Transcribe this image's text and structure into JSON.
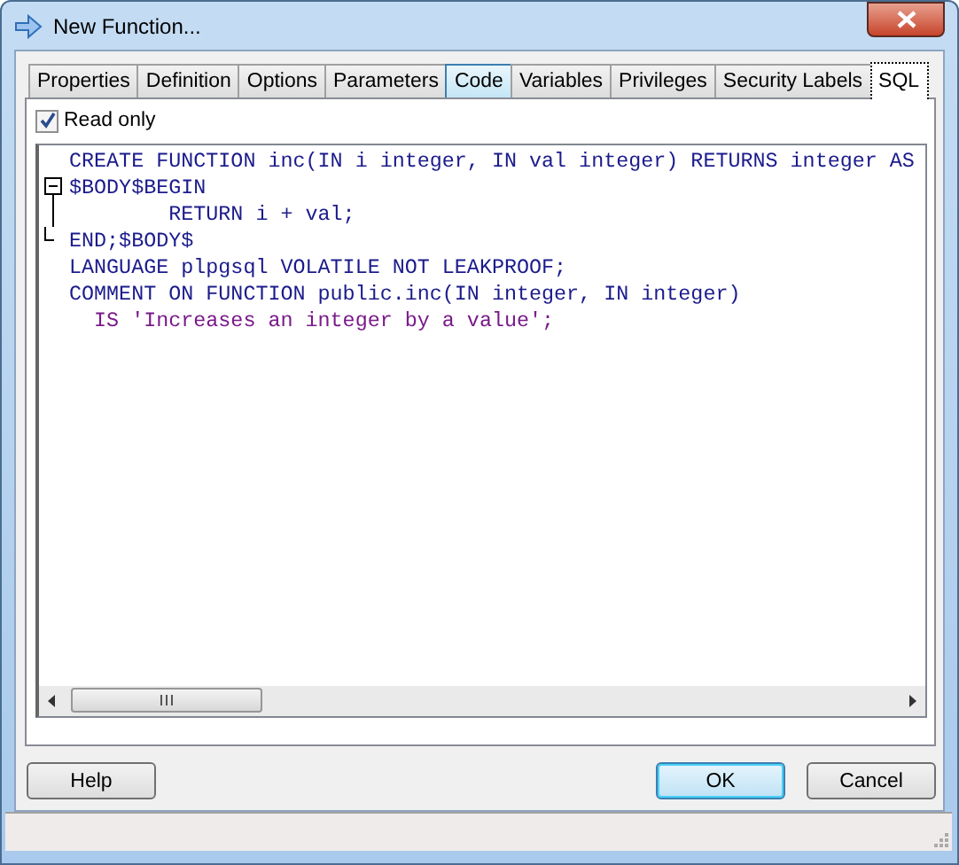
{
  "window": {
    "title": "New Function..."
  },
  "tabs": [
    {
      "label": "Properties",
      "selected": false,
      "hovered": false
    },
    {
      "label": "Definition",
      "selected": false,
      "hovered": false
    },
    {
      "label": "Options",
      "selected": false,
      "hovered": false
    },
    {
      "label": "Parameters",
      "selected": false,
      "hovered": false
    },
    {
      "label": "Code",
      "selected": false,
      "hovered": true
    },
    {
      "label": "Variables",
      "selected": false,
      "hovered": false
    },
    {
      "label": "Privileges",
      "selected": false,
      "hovered": false
    },
    {
      "label": "Security Labels",
      "selected": false,
      "hovered": false
    },
    {
      "label": "SQL",
      "selected": true,
      "hovered": false
    }
  ],
  "read_only": {
    "label": "Read only",
    "checked": true
  },
  "editor": {
    "lines": [
      {
        "kind": "plain",
        "quoted": false,
        "text": "CREATE FUNCTION inc(IN i integer, IN val integer) RETURNS integer AS"
      },
      {
        "kind": "fold-start",
        "quoted": false,
        "text": "$BODY$BEGIN"
      },
      {
        "kind": "fold-mid",
        "quoted": false,
        "text": "        RETURN i + val;"
      },
      {
        "kind": "fold-end",
        "quoted": false,
        "text": "END;$BODY$"
      },
      {
        "kind": "plain",
        "quoted": false,
        "text": "LANGUAGE plpgsql VOLATILE NOT LEAKPROOF;"
      },
      {
        "kind": "plain",
        "quoted": false,
        "text": "COMMENT ON FUNCTION public.inc(IN integer, IN integer)"
      },
      {
        "kind": "plain",
        "quoted": true,
        "text": "  IS 'Increases an integer by a value';"
      }
    ]
  },
  "buttons": [
    {
      "label": "Help",
      "default": false
    },
    {
      "label": "OK",
      "default": true
    },
    {
      "label": "Cancel",
      "default": false
    }
  ]
}
